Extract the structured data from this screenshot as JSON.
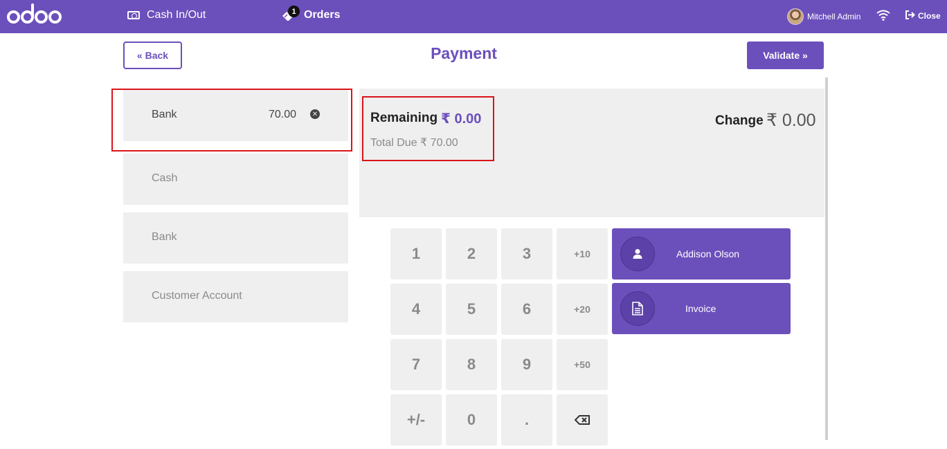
{
  "topbar": {
    "logo_text": "odoo",
    "cash_in_out": "Cash In/Out",
    "orders_label": "Orders",
    "orders_count": "1",
    "user_name": "Mitchell Admin",
    "close_label": "Close",
    "color": "#6b4fbb"
  },
  "header": {
    "back_label": "« Back",
    "title": "Payment",
    "validate_label": "Validate »"
  },
  "payment_lines": [
    {
      "method": "Bank",
      "amount": "70.00"
    }
  ],
  "payment_methods": [
    {
      "label": "Cash"
    },
    {
      "label": "Bank"
    },
    {
      "label": "Customer Account"
    }
  ],
  "summary": {
    "remaining_label": "Remaining",
    "remaining_value": "₹ 0.00",
    "total_due": "Total Due ₹ 70.00",
    "change_label": "Change",
    "change_value": "₹ 0.00"
  },
  "numpad": {
    "keys": [
      "1",
      "2",
      "3",
      "+10",
      "4",
      "5",
      "6",
      "+20",
      "7",
      "8",
      "9",
      "+50",
      "+/-",
      "0",
      ".",
      "backspace"
    ]
  },
  "actions": {
    "customer_name": "Addison Olson",
    "invoice_label": "Invoice"
  },
  "colors": {
    "accent": "#6b4fbb",
    "highlight": "#d9141a",
    "panel": "#efefef"
  }
}
